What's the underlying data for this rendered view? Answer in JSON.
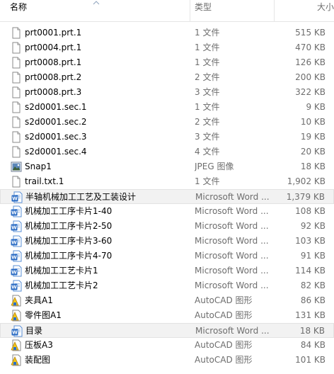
{
  "columns": {
    "name": "名称",
    "type": "类型",
    "size": "大小"
  },
  "files": [
    {
      "name": "prt0001.prt.1",
      "type": "1 文件",
      "size": "515 KB",
      "icon": "generic-file-icon"
    },
    {
      "name": "prt0004.prt.1",
      "type": "1 文件",
      "size": "470 KB",
      "icon": "generic-file-icon"
    },
    {
      "name": "prt0008.prt.1",
      "type": "1 文件",
      "size": "126 KB",
      "icon": "generic-file-icon"
    },
    {
      "name": "prt0008.prt.2",
      "type": "2 文件",
      "size": "200 KB",
      "icon": "generic-file-icon"
    },
    {
      "name": "prt0008.prt.3",
      "type": "3 文件",
      "size": "322 KB",
      "icon": "generic-file-icon"
    },
    {
      "name": "s2d0001.sec.1",
      "type": "1 文件",
      "size": "9 KB",
      "icon": "generic-file-icon"
    },
    {
      "name": "s2d0001.sec.2",
      "type": "2 文件",
      "size": "10 KB",
      "icon": "generic-file-icon"
    },
    {
      "name": "s2d0001.sec.3",
      "type": "3 文件",
      "size": "19 KB",
      "icon": "generic-file-icon"
    },
    {
      "name": "s2d0001.sec.4",
      "type": "4 文件",
      "size": "20 KB",
      "icon": "generic-file-icon"
    },
    {
      "name": "Snap1",
      "type": "JPEG 图像",
      "size": "18 KB",
      "icon": "image-file-icon"
    },
    {
      "name": "trail.txt.1",
      "type": "1 文件",
      "size": "1,902 KB",
      "icon": "generic-file-icon"
    },
    {
      "name": "半轴机械加工工艺及工装设计",
      "type": "Microsoft Word ...",
      "size": "1,379 KB",
      "icon": "word-document-icon",
      "highlight": true
    },
    {
      "name": "机械加工工序卡片1-40",
      "type": "Microsoft Word ...",
      "size": "108 KB",
      "icon": "word-document-icon"
    },
    {
      "name": "机械加工工序卡片2-50",
      "type": "Microsoft Word ...",
      "size": "92 KB",
      "icon": "word-document-icon"
    },
    {
      "name": "机械加工工序卡片3-60",
      "type": "Microsoft Word ...",
      "size": "103 KB",
      "icon": "word-document-icon"
    },
    {
      "name": "机械加工工序卡片4-70",
      "type": "Microsoft Word ...",
      "size": "91 KB",
      "icon": "word-document-icon"
    },
    {
      "name": "机械加工工艺卡片1",
      "type": "Microsoft Word ...",
      "size": "114 KB",
      "icon": "word-document-icon"
    },
    {
      "name": "机械加工工艺卡片2",
      "type": "Microsoft Word ...",
      "size": "82 KB",
      "icon": "word-document-icon"
    },
    {
      "name": "夹具A1",
      "type": "AutoCAD 图形",
      "size": "86 KB",
      "icon": "autocad-drawing-icon"
    },
    {
      "name": "零件图A1",
      "type": "AutoCAD 图形",
      "size": "131 KB",
      "icon": "autocad-drawing-icon"
    },
    {
      "name": "目录",
      "type": "Microsoft Word ...",
      "size": "18 KB",
      "icon": "word-document-icon",
      "highlight": true
    },
    {
      "name": "压板A3",
      "type": "AutoCAD 图形",
      "size": "84 KB",
      "icon": "autocad-drawing-icon"
    },
    {
      "name": "装配图",
      "type": "AutoCAD 图形",
      "size": "101 KB",
      "icon": "autocad-drawing-icon"
    }
  ],
  "colors": {
    "header_text": "#4c607a",
    "secondary_text": "#6d6d6d",
    "word_blue": "#2b6cc4",
    "autocad_yellow": "#f0c419"
  }
}
